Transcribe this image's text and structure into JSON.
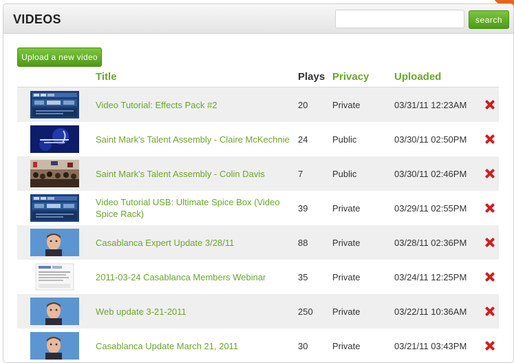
{
  "panel": {
    "title": "VIDEOS",
    "search": {
      "value": "",
      "placeholder": "",
      "button_label": "search"
    }
  },
  "toolbar": {
    "upload_label": "Upload a new video"
  },
  "table": {
    "columns": {
      "title": "Title",
      "plays": "Plays",
      "privacy": "Privacy",
      "uploaded": "Uploaded"
    },
    "rows": [
      {
        "thumbnail": "screen-capture",
        "title": "Video Tutorial: Effects Pack #2",
        "plays": "20",
        "privacy": "Private",
        "uploaded": "03/31/11 12:23AM"
      },
      {
        "thumbnail": "dark-blue-title-card",
        "title": "Saint Mark's Talent Assembly - Claire McKechnie",
        "plays": "24",
        "privacy": "Public",
        "uploaded": "03/30/11 02:50PM"
      },
      {
        "thumbnail": "crowd-in-gym",
        "title": "Saint Mark's Talent Assembly - Colin Davis",
        "plays": "7",
        "privacy": "Public",
        "uploaded": "03/30/11 02:46PM"
      },
      {
        "thumbnail": "screen-capture",
        "title": "Video Tutorial USB: Ultimate Spice Box (Video Spice Rack)",
        "plays": "39",
        "privacy": "Private",
        "uploaded": "03/29/11 02:55PM"
      },
      {
        "thumbnail": "presenter-face",
        "title": "Casablanca Expert Update 3/28/11",
        "plays": "88",
        "privacy": "Private",
        "uploaded": "03/28/11 02:36PM"
      },
      {
        "thumbnail": "document-page",
        "title": "2011-03-24 Casablanca Members Webinar",
        "plays": "35",
        "privacy": "Private",
        "uploaded": "03/24/11 12:25PM"
      },
      {
        "thumbnail": "presenter-face",
        "title": "Web update 3-21-2011",
        "plays": "250",
        "privacy": "Private",
        "uploaded": "03/22/11 10:36AM"
      },
      {
        "thumbnail": "presenter-face",
        "title": "Casablanca Update March 21, 2011",
        "plays": "30",
        "privacy": "Private",
        "uploaded": "03/21/11 03:43PM"
      }
    ]
  },
  "colors": {
    "accent_green": "#6aa72a",
    "button_green": "#5aa81f",
    "delete_red": "#d11f1f",
    "ribbon_orange": "#e8641c"
  }
}
